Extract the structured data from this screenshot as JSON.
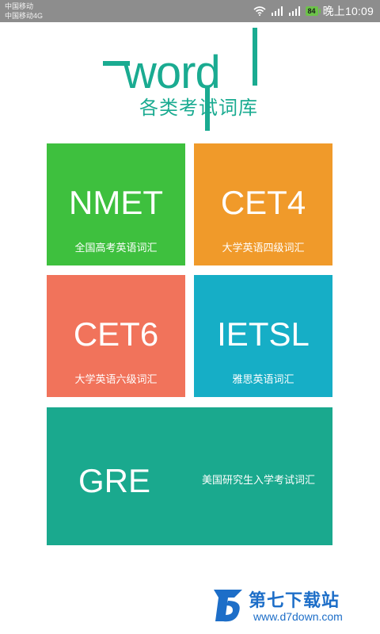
{
  "status_bar": {
    "carrier_1": "中国移动",
    "carrier_2": "中国移动4G",
    "battery": "84",
    "time": "晚上10:09",
    "icons": [
      "wifi-icon",
      "signal-icon",
      "signal-icon",
      "battery-icon"
    ]
  },
  "logo": {
    "word": "word",
    "subtitle": "各类考试词库",
    "color": "#1aab91"
  },
  "tiles": [
    {
      "code": "NMET",
      "desc": "全国高考英语词汇",
      "color": "#3ec03e"
    },
    {
      "code": "CET4",
      "desc": "大学英语四级词汇",
      "color": "#f09a2a"
    },
    {
      "code": "CET6",
      "desc": "大学英语六级词汇",
      "color": "#f1735b"
    },
    {
      "code": "IETSL",
      "desc": "雅思英语词汇",
      "color": "#16aec6"
    },
    {
      "code": "GRE",
      "desc": "美国研究生入学考试词汇",
      "color": "#1aa98e"
    }
  ],
  "watermark": {
    "name": "第七下载站",
    "url": "www.d7down.com"
  }
}
